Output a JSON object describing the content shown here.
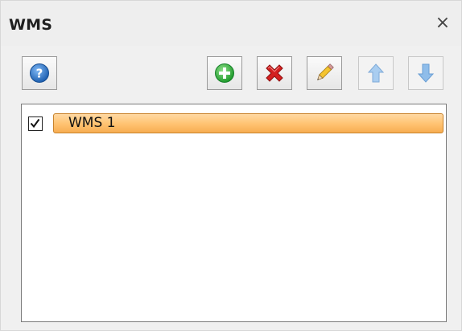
{
  "window": {
    "title": "WMS",
    "close_glyph": "×"
  },
  "toolbar": {
    "help_icon": "help-icon",
    "add_icon": "add-icon",
    "delete_icon": "delete-icon",
    "edit_icon": "edit-icon",
    "move_up_icon": "arrow-up-icon",
    "move_down_icon": "arrow-down-icon",
    "move_up_enabled": false,
    "move_down_enabled": false
  },
  "list": {
    "items": [
      {
        "label": "WMS 1",
        "checked": true,
        "selected": true
      }
    ]
  },
  "colors": {
    "selection_fill": "#ffc270",
    "selection_border": "#c9822a",
    "add_green": "#2fae3a",
    "delete_red": "#d42020",
    "help_blue": "#2a6fc0",
    "arrow_disabled": "#9cc3ea"
  }
}
